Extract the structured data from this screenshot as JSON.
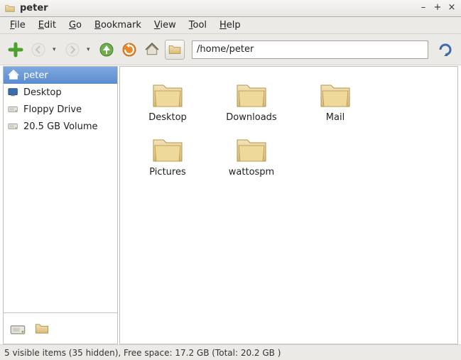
{
  "window": {
    "title": "peter"
  },
  "menu": {
    "file": "File",
    "edit": "Edit",
    "go": "Go",
    "bookmark": "Bookmark",
    "view": "View",
    "tool": "Tool",
    "help": "Help"
  },
  "toolbar": {
    "path": "/home/peter"
  },
  "sidebar": {
    "items": [
      {
        "name": "peter",
        "icon": "home",
        "selected": true
      },
      {
        "name": "Desktop",
        "icon": "desktop",
        "selected": false
      },
      {
        "name": "Floppy Drive",
        "icon": "drive",
        "selected": false
      },
      {
        "name": "20.5 GB Volume",
        "icon": "drive",
        "selected": false
      }
    ]
  },
  "files": [
    {
      "name": "Desktop"
    },
    {
      "name": "Downloads"
    },
    {
      "name": "Mail"
    },
    {
      "name": "Pictures"
    },
    {
      "name": "wattospm"
    }
  ],
  "status": {
    "visible": 5,
    "hidden": 35,
    "free": "17.2 GB",
    "total": "20.2 GB"
  }
}
